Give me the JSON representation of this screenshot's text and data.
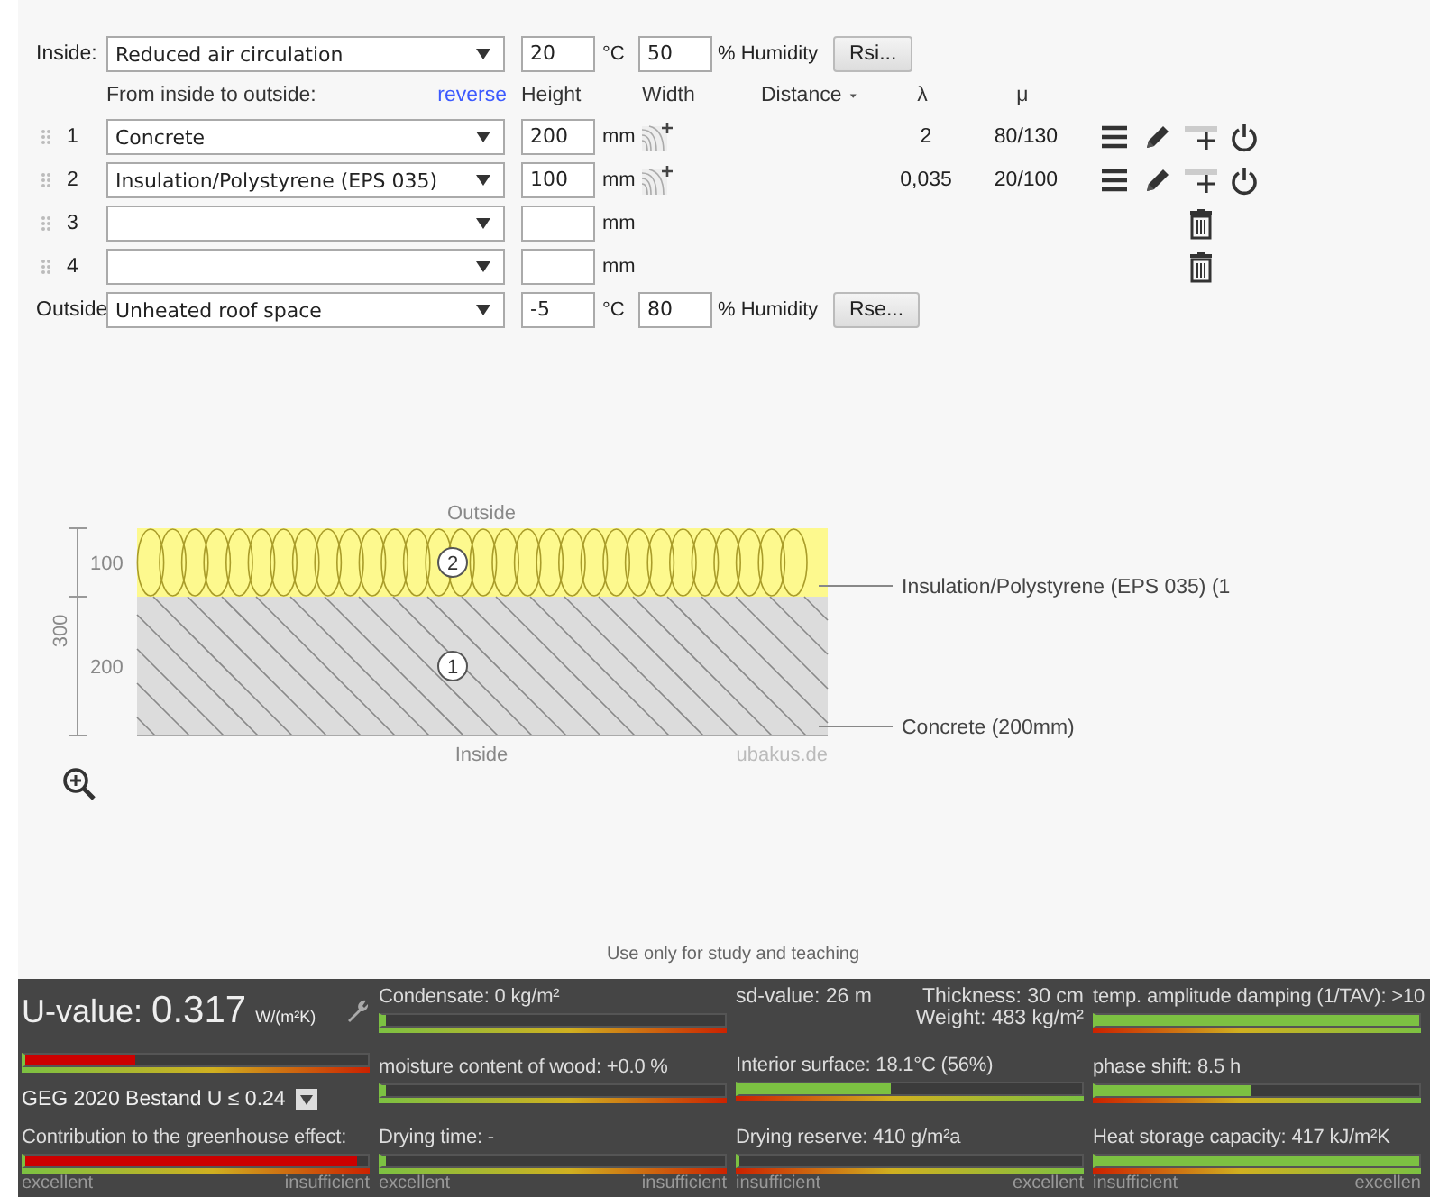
{
  "inside": {
    "label": "Inside:",
    "climate": "Reduced air circulation",
    "temperature": "20",
    "temp_unit": "°C",
    "humidity": "50",
    "humidity_label": "% Humidity",
    "button": "Rsi..."
  },
  "header": {
    "direction": "From inside to outside:",
    "reverse": "reverse",
    "height": "Height",
    "width": "Width",
    "distance": "Distance",
    "lambda": "λ",
    "mu": "μ"
  },
  "layers": [
    {
      "kind": "filled",
      "number": "1",
      "material": "Concrete",
      "thickness": "200",
      "unit": "mm",
      "lambda": "2",
      "mu": "80/130"
    },
    {
      "kind": "filled",
      "number": "2",
      "material": "Insulation/Polystyrene (EPS 035)",
      "thickness": "100",
      "unit": "mm",
      "lambda": "0,035",
      "mu": "20/100"
    },
    {
      "kind": "empty",
      "number": "3",
      "unit": "mm"
    },
    {
      "kind": "empty",
      "number": "4",
      "unit": "mm"
    }
  ],
  "outside": {
    "label": "Outside",
    "climate": "Unheated roof space",
    "temperature": "-5",
    "temp_unit": "°C",
    "humidity": "80",
    "humidity_label": "% Humidity",
    "button": "Rse..."
  },
  "diagram": {
    "top_label": "Outside",
    "bottom_label": "Inside",
    "watermark": "ubakus.de",
    "total": "300",
    "layers": [
      {
        "kind": "insulation",
        "number": "2",
        "dim": "100",
        "caption": "Insulation/Polystyrene (EPS 035) (1"
      },
      {
        "kind": "concrete",
        "number": "1",
        "dim": "200",
        "caption": "Concrete (200mm)"
      }
    ]
  },
  "notice": "Use only for study and teaching",
  "results": [
    {
      "scale": {
        "left": "excellent",
        "right": "insufficient",
        "reversed": false
      },
      "items": [
        {
          "kind": "headline",
          "label": "U-value:",
          "value": "0.317",
          "unit": "W/(m²K)"
        },
        {
          "kind": "meter",
          "level": 0.32,
          "color": "#cc0000"
        },
        {
          "kind": "standard",
          "text": "GEG 2020 Bestand U ≤ 0.24"
        },
        {
          "kind": "meter",
          "label": "Contribution to the greenhouse effect:",
          "level": 0.97,
          "color": "#cc0000"
        }
      ]
    },
    {
      "scale": {
        "left": "excellent",
        "right": "insufficient",
        "reversed": false
      },
      "items": [
        {
          "kind": "meter",
          "label": "Condensate: 0 kg/m²",
          "level": 0.01,
          "color": "#7cc142"
        },
        {
          "kind": "meter",
          "label": "moisture content of wood: +0.0 %",
          "level": 0.01,
          "color": "#7cc142"
        },
        {
          "kind": "meter",
          "label": "Drying time: -",
          "level": 0.01,
          "color": "#7cc142"
        }
      ]
    },
    {
      "scale": {
        "left": "insufficient",
        "right": "excellent",
        "reversed": true
      },
      "items": [
        {
          "kind": "info",
          "label": "sd-value: 26 m",
          "lines": [
            "Thickness: 30 cm",
            "Weight: 483 kg/m²"
          ]
        },
        {
          "kind": "meter",
          "label": "Interior surface: 18.1°C (56%)",
          "level": 0.44,
          "color": "#7cc142"
        },
        {
          "kind": "meter",
          "label": "Drying reserve: 410 g/m²a"
        }
      ]
    },
    {
      "scale": {
        "left": "insufficient",
        "right": "excellen",
        "reversed": true
      },
      "items": [
        {
          "kind": "meter",
          "label": "temp. amplitude damping (1/TAV): >10",
          "level": 1,
          "color": "#7cc142"
        },
        {
          "kind": "meter",
          "label": "phase shift: 8.5 h",
          "level": 0.48,
          "color": "#7cc142"
        },
        {
          "kind": "meter",
          "label": "Heat storage capacity: 417 kJ/m²K",
          "level": 1,
          "color": "#7cc142"
        }
      ]
    }
  ]
}
